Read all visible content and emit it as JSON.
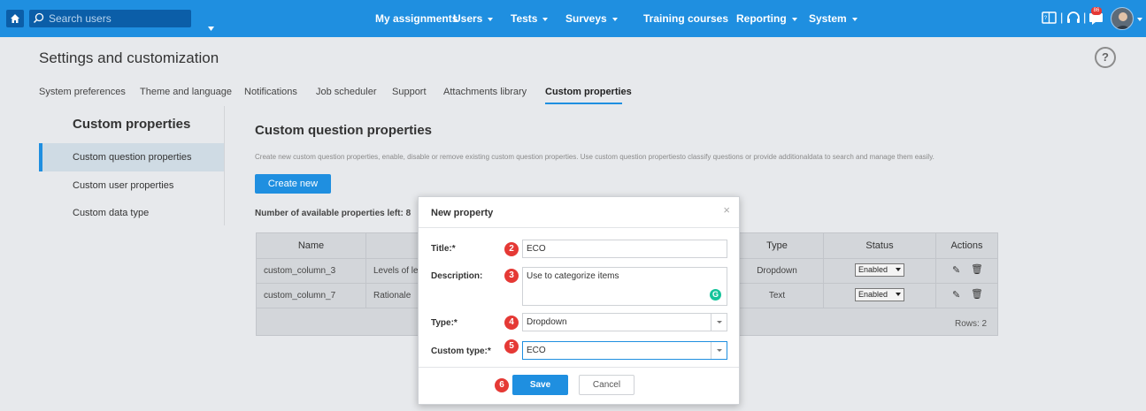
{
  "topbar": {
    "search_placeholder": "Search users",
    "nav": [
      {
        "label": "My assignments",
        "has_caret": false
      },
      {
        "label": "Users",
        "has_caret": true
      },
      {
        "label": "Tests",
        "has_caret": true
      },
      {
        "label": "Surveys",
        "has_caret": true
      },
      {
        "label": "Training courses",
        "has_caret": false
      },
      {
        "label": "Reporting",
        "has_caret": true
      },
      {
        "label": "System",
        "has_caret": true
      }
    ],
    "notification_count": "86",
    "icons": [
      "home-icon",
      "search-icon",
      "book-icon",
      "headset-icon",
      "chat-icon",
      "avatar"
    ],
    "bar_color": "#1f8fe0"
  },
  "page": {
    "title": "Settings and customization",
    "help": "?",
    "tabs": [
      {
        "label": "System preferences",
        "active": false
      },
      {
        "label": "Theme and language",
        "active": false
      },
      {
        "label": "Notifications",
        "active": false
      },
      {
        "label": "Job scheduler",
        "active": false
      },
      {
        "label": "Support",
        "active": false
      },
      {
        "label": "Attachments library",
        "active": false
      },
      {
        "label": "Custom properties",
        "active": true
      }
    ]
  },
  "sidebar": {
    "title": "Custom properties",
    "items": [
      {
        "label": "Custom question properties",
        "active": true
      },
      {
        "label": "Custom user properties",
        "active": false
      },
      {
        "label": "Custom data type",
        "active": false
      }
    ]
  },
  "main": {
    "title": "Custom question properties",
    "description": "Create new custom question properties, enable, disable or remove existing custom question properties. Use custom question propertiesto classify questions or provide additionaldata to search and manage them easily.",
    "create_label": "Create new",
    "available_text": "Number of available properties left: 8",
    "grid": {
      "headers": {
        "name": "Name",
        "type": "Type",
        "status": "Status",
        "actions": "Actions"
      },
      "rows": [
        {
          "name": "custom_column_3",
          "title": "Levels of le",
          "type": "Dropdown",
          "status": "Enabled"
        },
        {
          "name": "custom_column_7",
          "title": "Rationale",
          "type": "Text",
          "status": "Enabled"
        }
      ],
      "rows_label": "Rows: 2"
    }
  },
  "modal": {
    "title": "New property",
    "close": "×",
    "fields": {
      "title_label": "Title:*",
      "title_value": "ECO",
      "description_label": "Description:",
      "description_value": "Use to categorize items",
      "type_label": "Type:*",
      "type_value": "Dropdown",
      "custom_type_label": "Custom type:*",
      "custom_type_value": "ECO"
    },
    "save_label": "Save",
    "cancel_label": "Cancel",
    "steps": [
      "2",
      "3",
      "4",
      "5",
      "6"
    ]
  }
}
